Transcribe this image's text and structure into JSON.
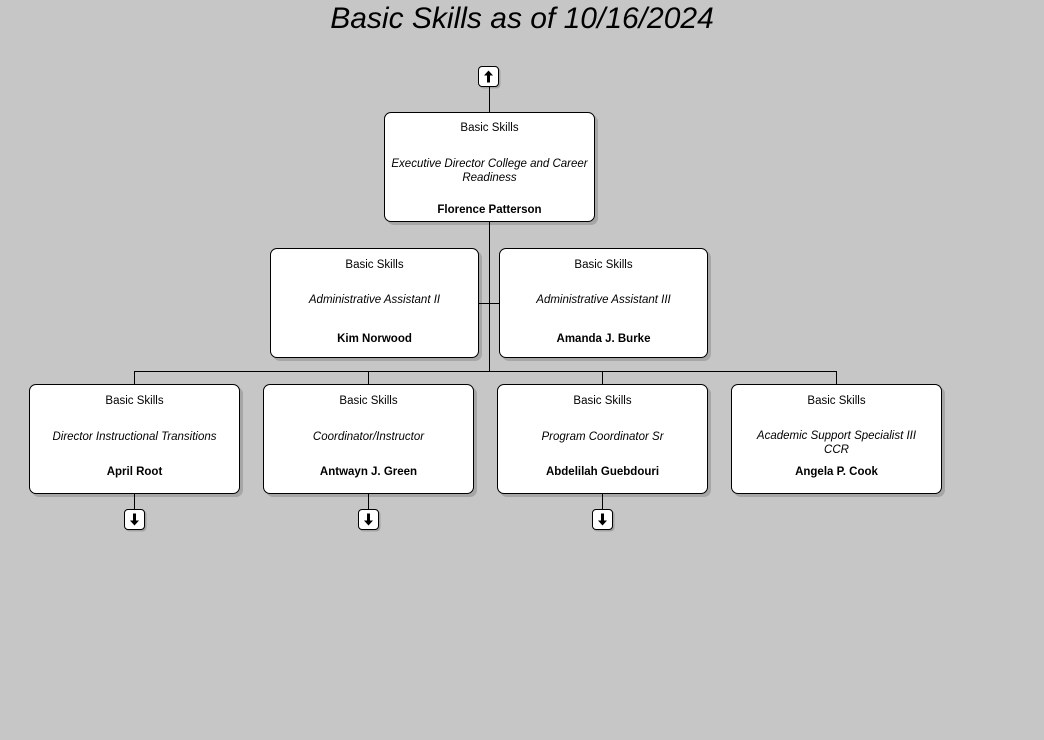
{
  "page": {
    "title": "Basic Skills as of 10/16/2024",
    "background_color": "#c6c6c6",
    "node_fill_color": "#ffffff",
    "node_border_color": "#000000"
  },
  "controls": {
    "up_arrow": {
      "icon": "arrow-up-icon",
      "label": "Show parent"
    },
    "down_arrow": {
      "icon": "arrow-down-icon",
      "label": "Show children"
    }
  },
  "chart_data": {
    "type": "orgchart",
    "title": "Basic Skills as of 10/16/2024",
    "nodes": [
      {
        "id": "root",
        "level": 1,
        "department": "Basic Skills",
        "position": "Executive Director College and Career Readiness",
        "name": "Florence Patterson",
        "has_parent_toggle": true,
        "has_children_toggle": false
      },
      {
        "id": "asst1",
        "level": 2,
        "department": "Basic Skills",
        "position": "Administrative Assistant II",
        "name": "Kim Norwood",
        "has_parent_toggle": false,
        "has_children_toggle": false
      },
      {
        "id": "asst2",
        "level": 2,
        "department": "Basic Skills",
        "position": "Administrative Assistant III",
        "name": "Amanda J. Burke",
        "has_parent_toggle": false,
        "has_children_toggle": false
      },
      {
        "id": "child1",
        "level": 3,
        "department": "Basic Skills",
        "position": "Director Instructional Transitions",
        "name": "April Root",
        "has_parent_toggle": false,
        "has_children_toggle": true
      },
      {
        "id": "child2",
        "level": 3,
        "department": "Basic Skills",
        "position": "Coordinator/Instructor",
        "name": "Antwayn J. Green",
        "has_parent_toggle": false,
        "has_children_toggle": true
      },
      {
        "id": "child3",
        "level": 3,
        "department": "Basic Skills",
        "position": "Program Coordinator Sr",
        "name": "Abdelilah Guebdouri",
        "has_parent_toggle": false,
        "has_children_toggle": true
      },
      {
        "id": "child4",
        "level": 3,
        "department": "Basic Skills",
        "position": "Academic Support Specialist III CCR",
        "name": "Angela P. Cook",
        "has_parent_toggle": false,
        "has_children_toggle": false
      }
    ]
  }
}
